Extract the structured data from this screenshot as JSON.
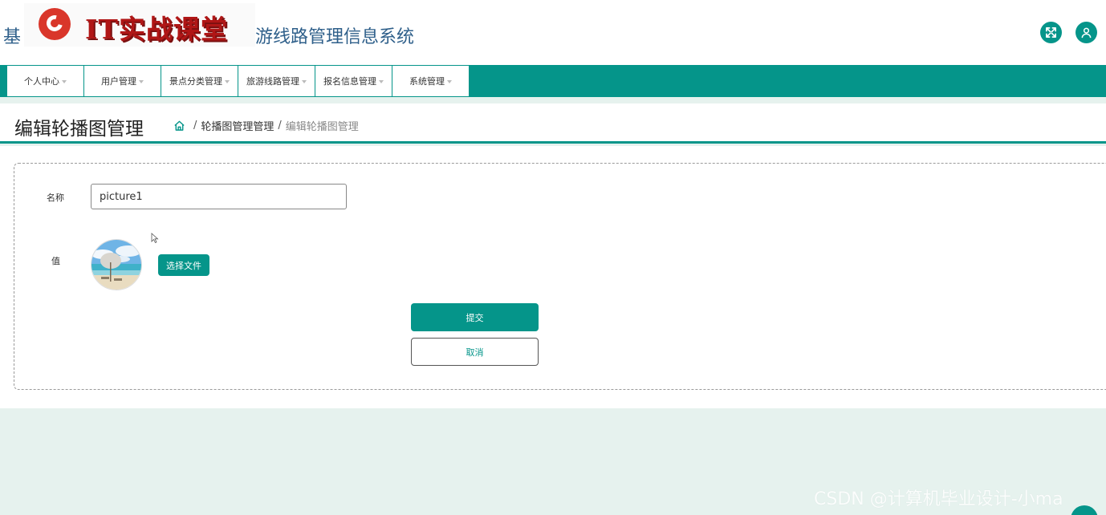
{
  "header": {
    "title_prefix": "基",
    "logo_text": "IT实战课堂",
    "title_suffix": "游线路管理信息系统",
    "icons": [
      "expand-icon",
      "user-icon"
    ],
    "accent_color": "#05958a"
  },
  "nav": {
    "items": [
      {
        "label": "个人中心"
      },
      {
        "label": "用户管理"
      },
      {
        "label": "景点分类管理"
      },
      {
        "label": "旅游线路管理"
      },
      {
        "label": "报名信息管理"
      },
      {
        "label": "系统管理"
      }
    ]
  },
  "page": {
    "title": "编辑轮播图管理",
    "breadcrumb": {
      "parent": "轮播图管理管理",
      "separator": "/",
      "current": "编辑轮播图管理"
    }
  },
  "form": {
    "name_label": "名称",
    "name_value": "picture1",
    "value_label": "值",
    "file_button": "选择文件",
    "submit_button": "提交",
    "cancel_button": "取消"
  },
  "watermark": "CSDN @计算机毕业设计-小ma"
}
